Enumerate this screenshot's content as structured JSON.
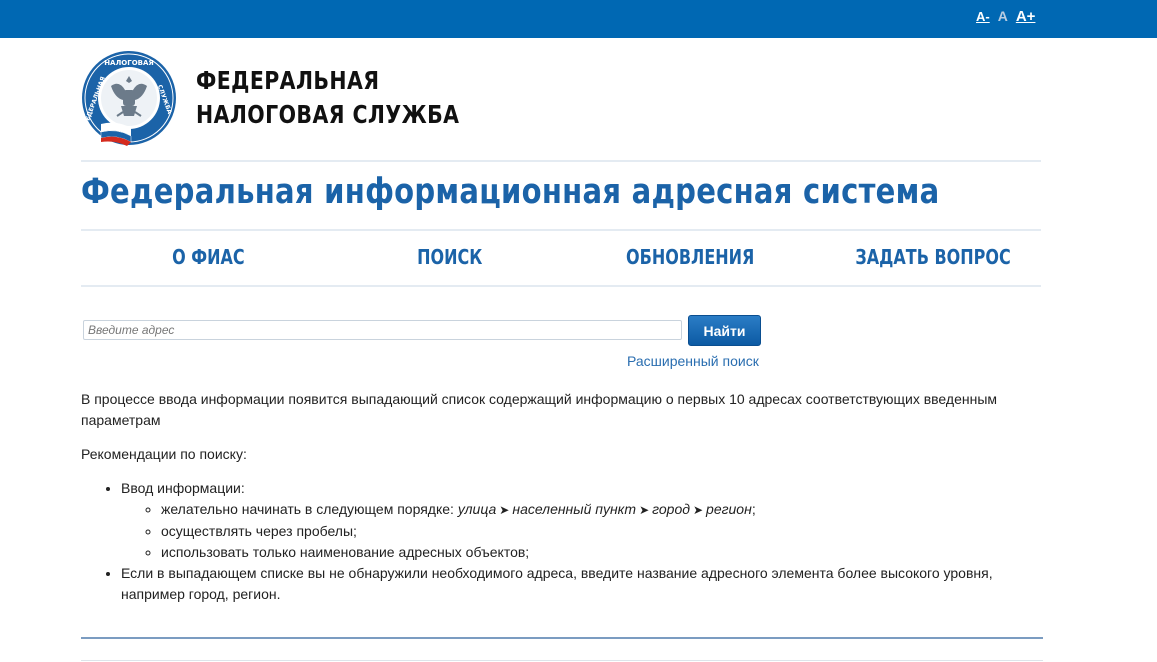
{
  "font_controls": {
    "smaller": "A-",
    "normal": "A",
    "larger": "A+"
  },
  "header": {
    "org_line1": "ФЕДЕРАЛЬНАЯ",
    "org_line2": "НАЛОГОВАЯ СЛУЖБА",
    "logo_icon": "fns-emblem-icon"
  },
  "site_title": "Федеральная информационная адресная система",
  "nav": [
    {
      "label": "О ФИАС"
    },
    {
      "label": "ПОИСК"
    },
    {
      "label": "ОБНОВЛЕНИЯ"
    },
    {
      "label": "ЗАДАТЬ ВОПРОС"
    }
  ],
  "search": {
    "placeholder": "Введите адрес",
    "value": "",
    "button_label": "Найти",
    "advanced_link": "Расширенный поиск"
  },
  "content": {
    "intro": "В процессе ввода информации появится выпадающий список содержащий информацию о первых 10 адресах соответствующих введенным параметрам",
    "rec_title": "Рекомендации по поиску:",
    "item1": "Ввод информации:",
    "sub1_prefix": "желательно начинать в следующем порядке: ",
    "order": [
      "улица",
      "населенный пункт",
      "город",
      "регион"
    ],
    "sub1_suffix": ";",
    "sub2": "осуществлять через пробелы;",
    "sub3": "использовать только наименование адресных объектов;",
    "item2": "Если в выпадающем списке вы не обнаружили необходимого адреса, введите название адресного элемента более высокого уровня, например город, регион."
  },
  "colors": {
    "topbar": "#0068b3",
    "title": "#1b63a8",
    "button": "#0c5aa3",
    "link": "#2a6eb0"
  }
}
